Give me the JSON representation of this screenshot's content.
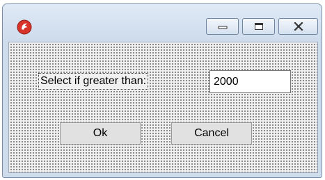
{
  "window": {
    "app_icon": "app-logo-icon",
    "controls": {
      "minimize_icon": "minimize-icon",
      "maximize_icon": "restore-icon",
      "close_icon": "close-icon"
    }
  },
  "form": {
    "label": "Select if greater than:",
    "threshold_value": "2000"
  },
  "buttons": {
    "ok_label": "Ok",
    "cancel_label": "Cancel"
  },
  "colors": {
    "accent": "#d8342a",
    "client_background": "#f0f0f0",
    "frame": "#cfdcec"
  }
}
